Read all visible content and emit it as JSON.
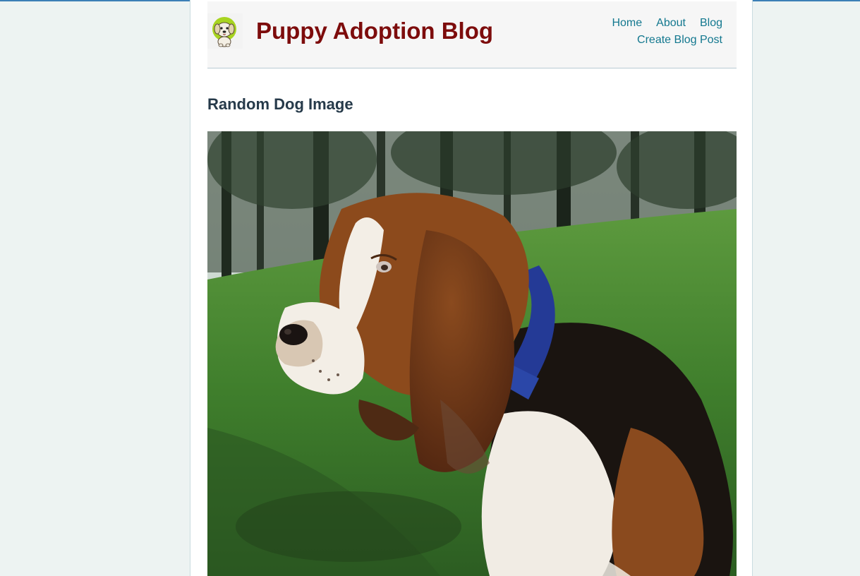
{
  "site": {
    "title": "Puppy Adoption Blog",
    "logo_icon": "puppy-logo-icon"
  },
  "nav": {
    "items": [
      {
        "label": "Home"
      },
      {
        "label": "About"
      },
      {
        "label": "Blog"
      },
      {
        "label": "Create Blog Post"
      }
    ]
  },
  "main": {
    "heading": "Random Dog Image",
    "image_alt": "basset hound in grass"
  },
  "colors": {
    "title": "#7d0c0c",
    "nav_link": "#13788f",
    "heading": "#263a4a",
    "background": "#edf3f2"
  }
}
